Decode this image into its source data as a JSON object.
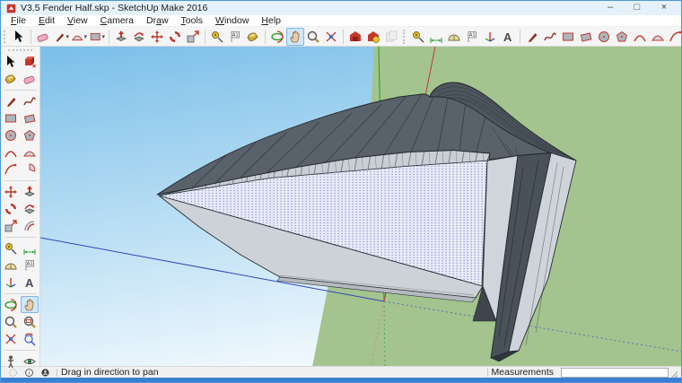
{
  "window": {
    "title": "V3.5 Fender Half.skp - SketchUp Make 2016",
    "minimize": "–",
    "maximize": "□",
    "close": "×"
  },
  "menu": {
    "items": [
      {
        "label": "File",
        "m": 0
      },
      {
        "label": "Edit",
        "m": 0
      },
      {
        "label": "View",
        "m": 0
      },
      {
        "label": "Camera",
        "m": 0
      },
      {
        "label": "Draw",
        "m": 2
      },
      {
        "label": "Tools",
        "m": 0
      },
      {
        "label": "Window",
        "m": 0
      },
      {
        "label": "Help",
        "m": 0
      }
    ]
  },
  "top_toolbar": {
    "items": [
      {
        "name": "select",
        "sym": "cursor"
      },
      {
        "sep": "line"
      },
      {
        "name": "eraser",
        "sym": "eraser"
      },
      {
        "name": "line",
        "sym": "pencil",
        "dd": true
      },
      {
        "name": "arc",
        "sym": "arc2",
        "dd": true
      },
      {
        "name": "rectangle",
        "sym": "rect",
        "dd": true
      },
      {
        "sep": "line"
      },
      {
        "name": "push-pull",
        "sym": "pushpull"
      },
      {
        "name": "follow-me",
        "sym": "followme"
      },
      {
        "name": "move",
        "sym": "move"
      },
      {
        "name": "rotate",
        "sym": "rotate"
      },
      {
        "name": "scale",
        "sym": "scale"
      },
      {
        "sep": "line"
      },
      {
        "name": "tape-measure",
        "sym": "tape"
      },
      {
        "name": "text",
        "sym": "textflag"
      },
      {
        "name": "paint-bucket",
        "sym": "bucket"
      },
      {
        "sep": "line"
      },
      {
        "name": "orbit",
        "sym": "orbit"
      },
      {
        "name": "pan",
        "sym": "hand",
        "active": true
      },
      {
        "name": "zoom",
        "sym": "zoom"
      },
      {
        "name": "zoom-extents",
        "sym": "zoomext"
      },
      {
        "sep": "line"
      },
      {
        "name": "3d-warehouse",
        "sym": "warehouse"
      },
      {
        "name": "extension-warehouse",
        "sym": "extwh"
      },
      {
        "name": "share-model",
        "sym": "share",
        "disabled": true
      },
      {
        "sep": "dotted"
      },
      {
        "name": "tape-measure-2",
        "sym": "tape"
      },
      {
        "name": "dimension",
        "sym": "dimension"
      },
      {
        "name": "protractor",
        "sym": "protractor"
      },
      {
        "name": "text-2",
        "sym": "textflag"
      },
      {
        "name": "axes",
        "sym": "axes"
      },
      {
        "name": "3d-text",
        "sym": "text3d"
      },
      {
        "sep": "line"
      },
      {
        "name": "line-2",
        "sym": "pencil"
      },
      {
        "name": "freehand",
        "sym": "freehand"
      },
      {
        "name": "rectangle-2",
        "sym": "rect"
      },
      {
        "name": "rotated-rectangle",
        "sym": "rotrect"
      },
      {
        "name": "circle",
        "sym": "circle"
      },
      {
        "name": "polygon",
        "sym": "polygon"
      },
      {
        "name": "arc-2",
        "sym": "arc"
      },
      {
        "name": "two-point-arc",
        "sym": "arc2"
      },
      {
        "name": "three-point-arc",
        "sym": "arc3"
      }
    ]
  },
  "left_toolbar": {
    "items": [
      {
        "name": "select",
        "sym": "cursor"
      },
      {
        "name": "make-component",
        "sym": "component"
      },
      {
        "name": "paint-bucket",
        "sym": "bucket"
      },
      {
        "name": "eraser",
        "sym": "eraser"
      },
      {
        "sep": true
      },
      {
        "name": "line",
        "sym": "pencil"
      },
      {
        "name": "freehand",
        "sym": "freehand"
      },
      {
        "name": "rectangle",
        "sym": "rect"
      },
      {
        "name": "rotated-rectangle",
        "sym": "rotrect"
      },
      {
        "name": "circle",
        "sym": "circle"
      },
      {
        "name": "polygon",
        "sym": "polygon"
      },
      {
        "name": "arc",
        "sym": "arc"
      },
      {
        "name": "two-point-arc",
        "sym": "arc2"
      },
      {
        "name": "three-point-arc",
        "sym": "arc3"
      },
      {
        "name": "pie",
        "sym": "pie"
      },
      {
        "sep": true
      },
      {
        "name": "move",
        "sym": "move"
      },
      {
        "name": "push-pull",
        "sym": "pushpull"
      },
      {
        "name": "rotate",
        "sym": "rotate"
      },
      {
        "name": "follow-me",
        "sym": "followme"
      },
      {
        "name": "scale",
        "sym": "scale"
      },
      {
        "name": "offset",
        "sym": "offset"
      },
      {
        "sep": true
      },
      {
        "name": "tape-measure",
        "sym": "tape"
      },
      {
        "name": "dimension",
        "sym": "dimension"
      },
      {
        "name": "protractor",
        "sym": "protractor"
      },
      {
        "name": "text",
        "sym": "textflag"
      },
      {
        "name": "axes",
        "sym": "axes"
      },
      {
        "name": "3d-text",
        "sym": "text3d"
      },
      {
        "sep": true
      },
      {
        "name": "orbit",
        "sym": "orbit"
      },
      {
        "name": "pan",
        "sym": "hand",
        "active": true
      },
      {
        "name": "zoom",
        "sym": "zoom"
      },
      {
        "name": "zoom-window",
        "sym": "zoomwin"
      },
      {
        "name": "zoom-extents",
        "sym": "zoomext"
      },
      {
        "name": "previous-view",
        "sym": "prevview"
      },
      {
        "sep": true
      },
      {
        "name": "position-camera",
        "sym": "poscamera"
      },
      {
        "name": "look-around",
        "sym": "lookaround"
      }
    ]
  },
  "statusbar": {
    "icons": [
      {
        "name": "geolocation",
        "sym": "geo"
      },
      {
        "name": "credits",
        "sym": "info"
      },
      {
        "name": "claim-credit",
        "sym": "person"
      }
    ],
    "hint": "Drag in direction to pan",
    "measurements_label": "Measurements",
    "measurements_value": ""
  },
  "colors": {
    "titlebar_bg": "#e6f2fb",
    "frame_blue": "#3a80d2",
    "sky_top": "#7bbfe9",
    "sky_horizon": "#eef7fd",
    "ground_green": "#a3c48e",
    "model_dark": "#59616a",
    "model_light": "#ccd2d8",
    "selected_face_fill": "#e9ecf7",
    "selected_face_dot": "#8a94d6",
    "axis_red": "#c0392b",
    "axis_green": "#1d9b1d",
    "axis_blue": "#3344bb",
    "active_tool_highlight": "#cde7fb"
  }
}
